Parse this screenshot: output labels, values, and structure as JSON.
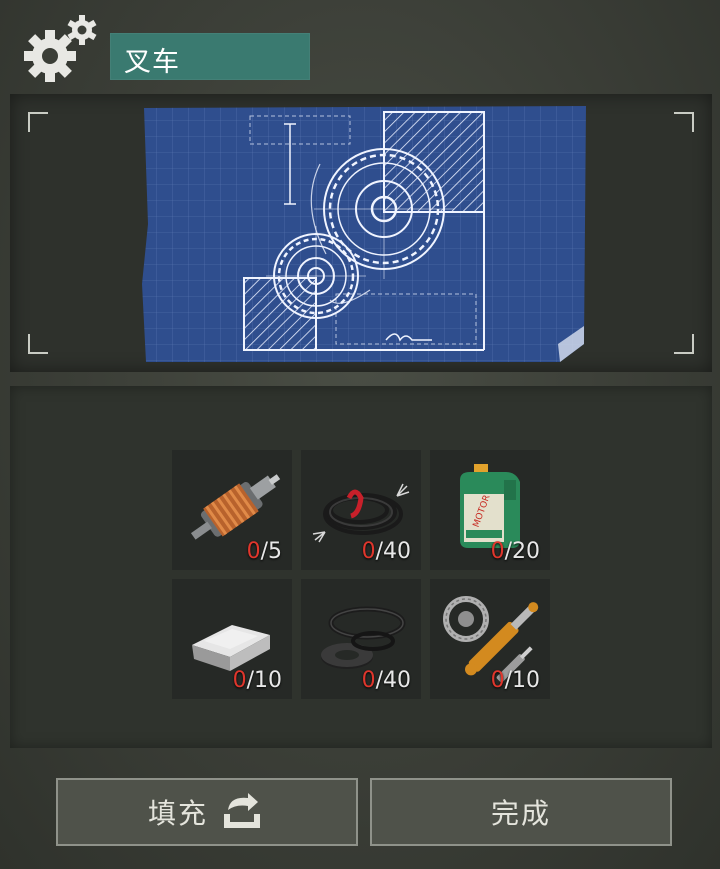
{
  "header": {
    "title": "叉车",
    "icon": "gears-icon",
    "accent_color": "#3a7a70"
  },
  "blueprint": {
    "icon": "blueprint-gears",
    "paper_color": "#2f4e8e"
  },
  "materials": [
    {
      "name": "electric-motor",
      "have": "0",
      "need": "/5"
    },
    {
      "name": "wires",
      "have": "0",
      "need": "/40"
    },
    {
      "name": "motor-oil",
      "have": "0",
      "need": "/20"
    },
    {
      "name": "metal-ingot",
      "have": "0",
      "need": "/10"
    },
    {
      "name": "rubber-seals",
      "have": "0",
      "need": "/40"
    },
    {
      "name": "hydraulic-parts",
      "have": "0",
      "need": "/10"
    }
  ],
  "buttons": {
    "fill_label": "填充",
    "done_label": "完成"
  },
  "colors": {
    "shortage": "#e0362c"
  }
}
